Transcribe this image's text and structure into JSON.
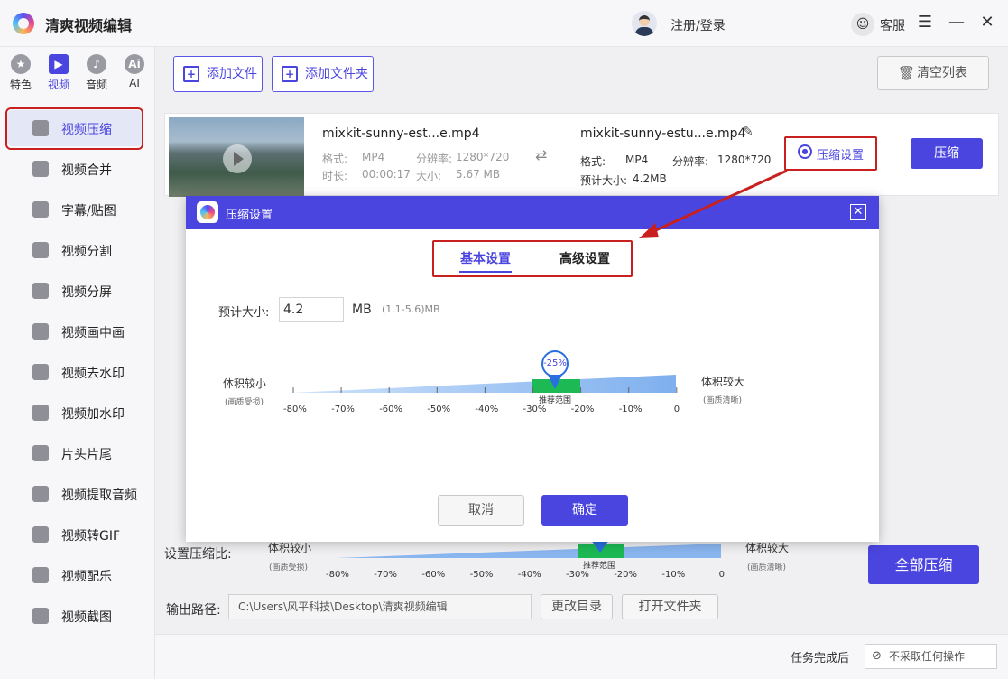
{
  "app": {
    "title": "清爽视频编辑",
    "login": "注册/登录",
    "service": "客服"
  },
  "categories": [
    {
      "label": "特色",
      "glyph": "★"
    },
    {
      "label": "视频",
      "glyph": "▶"
    },
    {
      "label": "音频",
      "glyph": "♪"
    },
    {
      "label": "AI",
      "glyph": "Ai"
    }
  ],
  "nav": [
    "视频压缩",
    "视频合并",
    "字幕/贴图",
    "视频分割",
    "视频分屏",
    "视频画中画",
    "视频去水印",
    "视频加水印",
    "片头片尾",
    "视频提取音频",
    "视频转GIF",
    "视频配乐",
    "视频截图"
  ],
  "toolbar": {
    "add_file": "添加文件",
    "add_folder": "添加文件夹",
    "clear": "清空列表"
  },
  "file": {
    "src_name": "mixkit-sunny-est...e.mp4",
    "format_label": "格式:",
    "format": "MP4",
    "res_label": "分辨率:",
    "res": "1280*720",
    "duration_label": "时长:",
    "duration": "00:00:17",
    "size_label": "大小:",
    "size": "5.67 MB",
    "out_name": "mixkit-sunny-estu...e.mp4",
    "out_format": "MP4",
    "out_res": "1280*720",
    "est_label": "预计大小:",
    "est": "4.2MB",
    "settings_btn": "压缩设置",
    "compress_btn": "压缩"
  },
  "bottom": {
    "ratio_label": "设置压缩比:",
    "small": "体积较小",
    "small_sub": "(画质受损)",
    "large": "体积较大",
    "large_sub": "(画质清晰)",
    "recommend": "推荐范围",
    "ticks": [
      "-80%",
      "-70%",
      "-60%",
      "-50%",
      "-40%",
      "-30%",
      "-20%",
      "-10%",
      "0"
    ],
    "compress_all": "全部压缩",
    "output_label": "输出路径:",
    "path": "C:\\Users\\风平科技\\Desktop\\清爽视频编辑",
    "change_dir": "更改目录",
    "open_folder": "打开文件夹",
    "after_label": "任务完成后",
    "after_value": "不采取任何操作"
  },
  "dialog": {
    "title": "压缩设置",
    "tab_basic": "基本设置",
    "tab_advanced": "高级设置",
    "est_label": "预计大小:",
    "est_value": "4.2",
    "unit": "MB",
    "range": "(1.1-5.6)MB",
    "small": "体积较小",
    "small_sub": "(画质受损)",
    "large": "体积较大",
    "large_sub": "(画质清晰)",
    "pin": "-25%",
    "recommend": "推荐范围",
    "ticks": [
      "-80%",
      "-70%",
      "-60%",
      "-50%",
      "-40%",
      "-30%",
      "-20%",
      "-10%",
      "0"
    ],
    "cancel": "取消",
    "confirm": "确定",
    "compression_value_percent": -25
  },
  "colors": {
    "accent": "#4b45e0",
    "highlight": "#c8201e",
    "recommend": "#1db954"
  }
}
